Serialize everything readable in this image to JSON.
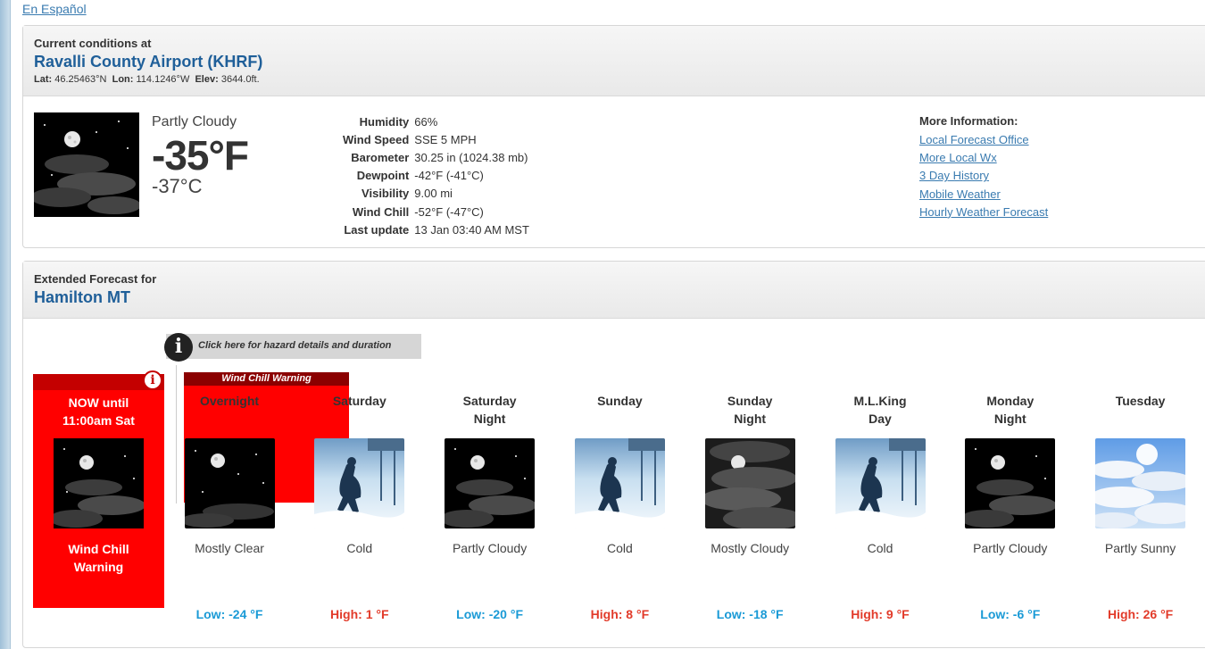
{
  "language_link": "En Español",
  "current": {
    "label": "Current conditions at",
    "station": "Ravalli County Airport (KHRF)",
    "lat_label": "Lat:",
    "lat": "46.25463°N",
    "lon_label": "Lon:",
    "lon": "114.1246°W",
    "elev_label": "Elev:",
    "elev": "3644.0ft.",
    "summary": "Partly Cloudy",
    "temp_f": "-35°F",
    "temp_c": "-37°C",
    "icon": "night-partly-cloudy",
    "details": [
      {
        "key": "Humidity",
        "value": "66%"
      },
      {
        "key": "Wind Speed",
        "value": "SSE 5 MPH"
      },
      {
        "key": "Barometer",
        "value": "30.25 in (1024.38 mb)"
      },
      {
        "key": "Dewpoint",
        "value": "-42°F (-41°C)"
      },
      {
        "key": "Visibility",
        "value": "9.00 mi"
      },
      {
        "key": "Wind Chill",
        "value": "-52°F (-47°C)"
      },
      {
        "key": "Last update",
        "value": "13 Jan 03:40 AM MST"
      }
    ],
    "more_info": {
      "title": "More Information:",
      "links": [
        "Local Forecast Office",
        "More Local Wx",
        "3 Day History",
        "Mobile Weather",
        "Hourly Weather Forecast"
      ]
    }
  },
  "forecast": {
    "label": "Extended Forecast for",
    "location": "Hamilton MT",
    "hazard_link": "Click here for hazard details and duration",
    "now": {
      "title_line1": "NOW until",
      "title_line2": "11:00am Sat",
      "label_line1": "Wind Chill",
      "label_line2": "Warning"
    },
    "warning_banner": "Wind Chill Warning",
    "colors": {
      "low": "#1a9ad6",
      "high": "#e23b2a",
      "hazard": "#ff0000"
    },
    "periods": [
      {
        "name1": "Overnight",
        "name2": "",
        "short": "Mostly Clear",
        "temp": "Low: -24 °F",
        "kind": "low",
        "icon": "night-clear"
      },
      {
        "name1": "Saturday",
        "name2": "",
        "short": "Cold",
        "temp": "High: 1 °F",
        "kind": "high",
        "icon": "cold"
      },
      {
        "name1": "Saturday",
        "name2": "Night",
        "short": "Partly Cloudy",
        "temp": "Low: -20 °F",
        "kind": "low",
        "icon": "night-partly-cloudy"
      },
      {
        "name1": "Sunday",
        "name2": "",
        "short": "Cold",
        "temp": "High: 8 °F",
        "kind": "high",
        "icon": "cold"
      },
      {
        "name1": "Sunday",
        "name2": "Night",
        "short": "Mostly Cloudy",
        "temp": "Low: -18 °F",
        "kind": "low",
        "icon": "night-mostly-cloudy"
      },
      {
        "name1": "M.L.King",
        "name2": "Day",
        "short": "Cold",
        "temp": "High: 9 °F",
        "kind": "high",
        "icon": "cold"
      },
      {
        "name1": "Monday",
        "name2": "Night",
        "short": "Partly Cloudy",
        "temp": "Low: -6 °F",
        "kind": "low",
        "icon": "night-partly-cloudy"
      },
      {
        "name1": "Tuesday",
        "name2": "",
        "short": "Partly Sunny",
        "temp": "High: 26 °F",
        "kind": "high",
        "icon": "partly-sunny"
      }
    ]
  }
}
